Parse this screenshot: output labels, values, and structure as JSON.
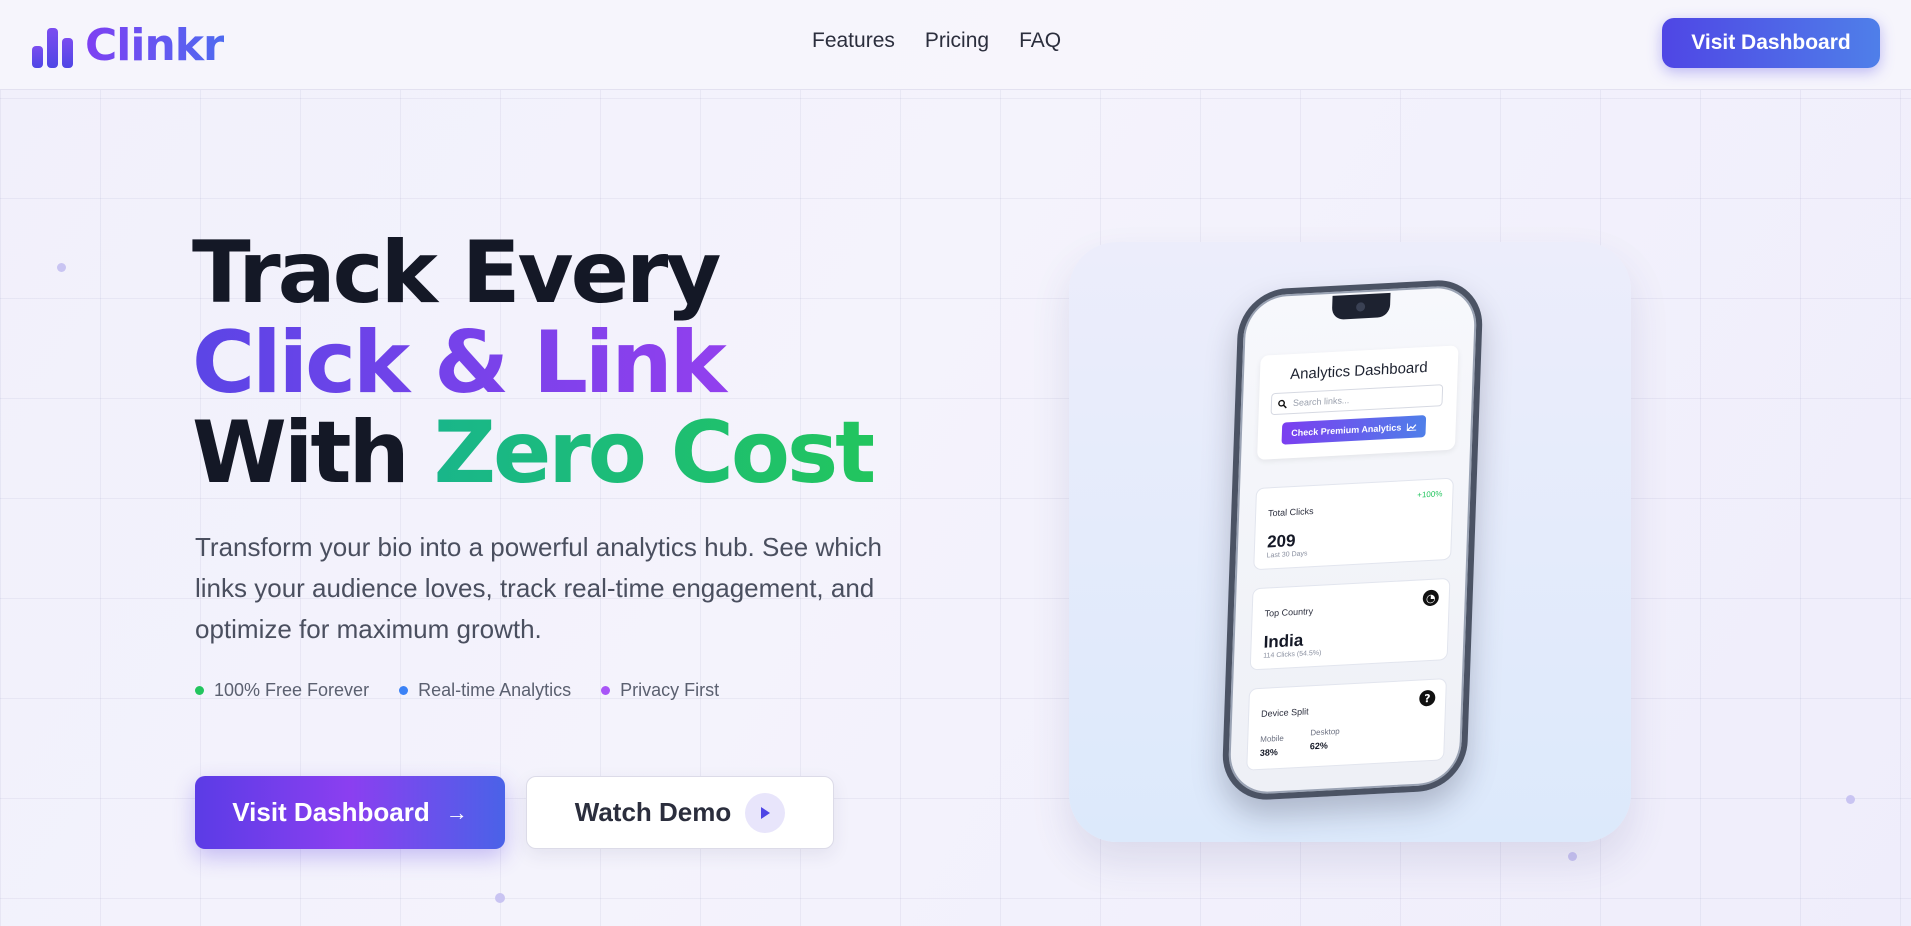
{
  "brand": {
    "name": "Clinkr"
  },
  "nav": {
    "items": [
      "Features",
      "Pricing",
      "FAQ"
    ],
    "cta": "Visit Dashboard"
  },
  "hero": {
    "title_line1": "Track Every",
    "title_line2": "Click & Link",
    "title_line3_prefix": "With",
    "title_line3_accent": "Zero Cost",
    "description": "Transform your bio into a powerful analytics hub. See which links your audience loves, track real-time engagement, and optimize for maximum growth.",
    "features": [
      {
        "label": "100% Free Forever",
        "color": "#22c55e"
      },
      {
        "label": "Real-time Analytics",
        "color": "#3b82f6"
      },
      {
        "label": "Privacy First",
        "color": "#a855f7"
      }
    ],
    "primary_cta": "Visit Dashboard",
    "secondary_cta": "Watch Demo"
  },
  "phone": {
    "title": "Analytics Dashboard",
    "search_placeholder": "Search links...",
    "premium_button": "Check Premium Analytics",
    "total_clicks": {
      "label": "Total Clicks",
      "badge": "+100%",
      "value": "209",
      "sub": "Last 30 Days"
    },
    "top_country": {
      "label": "Top Country",
      "value": "India",
      "sub": "114 Clicks (54.5%)"
    },
    "device_split": {
      "label": "Device Split",
      "mobile_label": "Mobile",
      "mobile_value": "38%",
      "desktop_label": "Desktop",
      "desktop_value": "62%"
    }
  },
  "colors": {
    "accent": "#4f46e5",
    "purple": "#8b3ff0",
    "green": "#22c55e"
  }
}
